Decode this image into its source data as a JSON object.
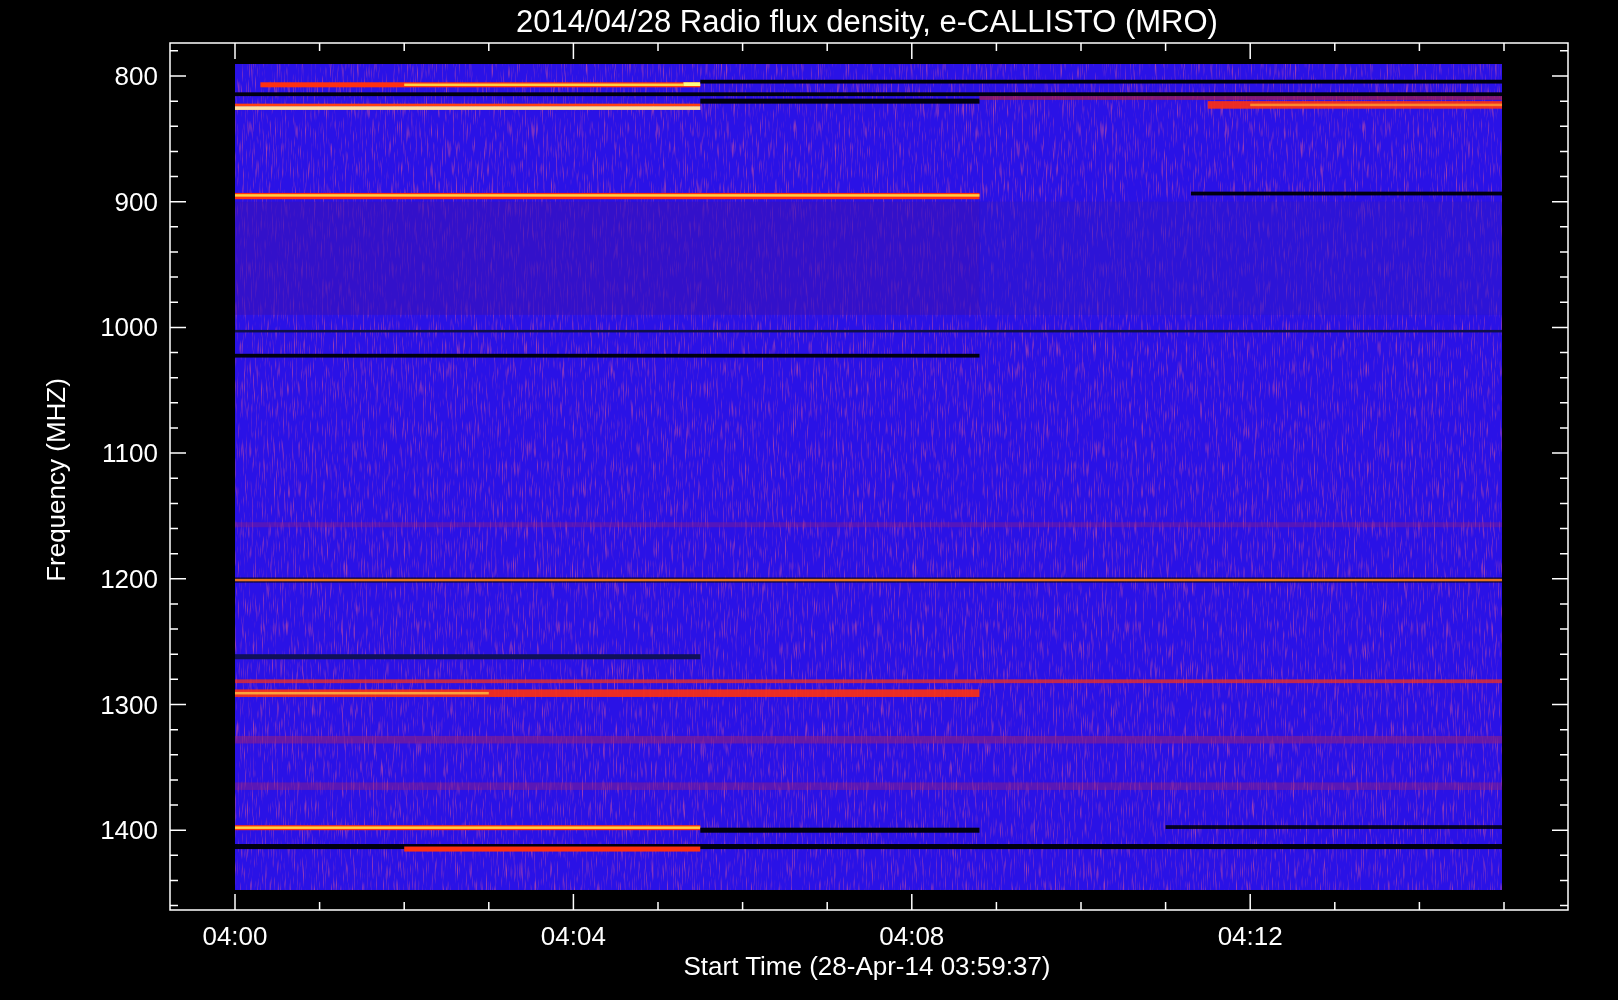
{
  "title": "2014/04/28  Radio flux density, e-CALLISTO (MRO)",
  "y_axis": {
    "title": "Frequency (MHZ)",
    "tick_labels": [
      "800",
      "900",
      "1000",
      "1100",
      "1200",
      "1300",
      "1400"
    ]
  },
  "x_axis": {
    "title": "Start Time (28-Apr-14 03:59:37)",
    "tick_labels": [
      "04:00",
      "04:04",
      "04:08",
      "04:12"
    ]
  }
}
